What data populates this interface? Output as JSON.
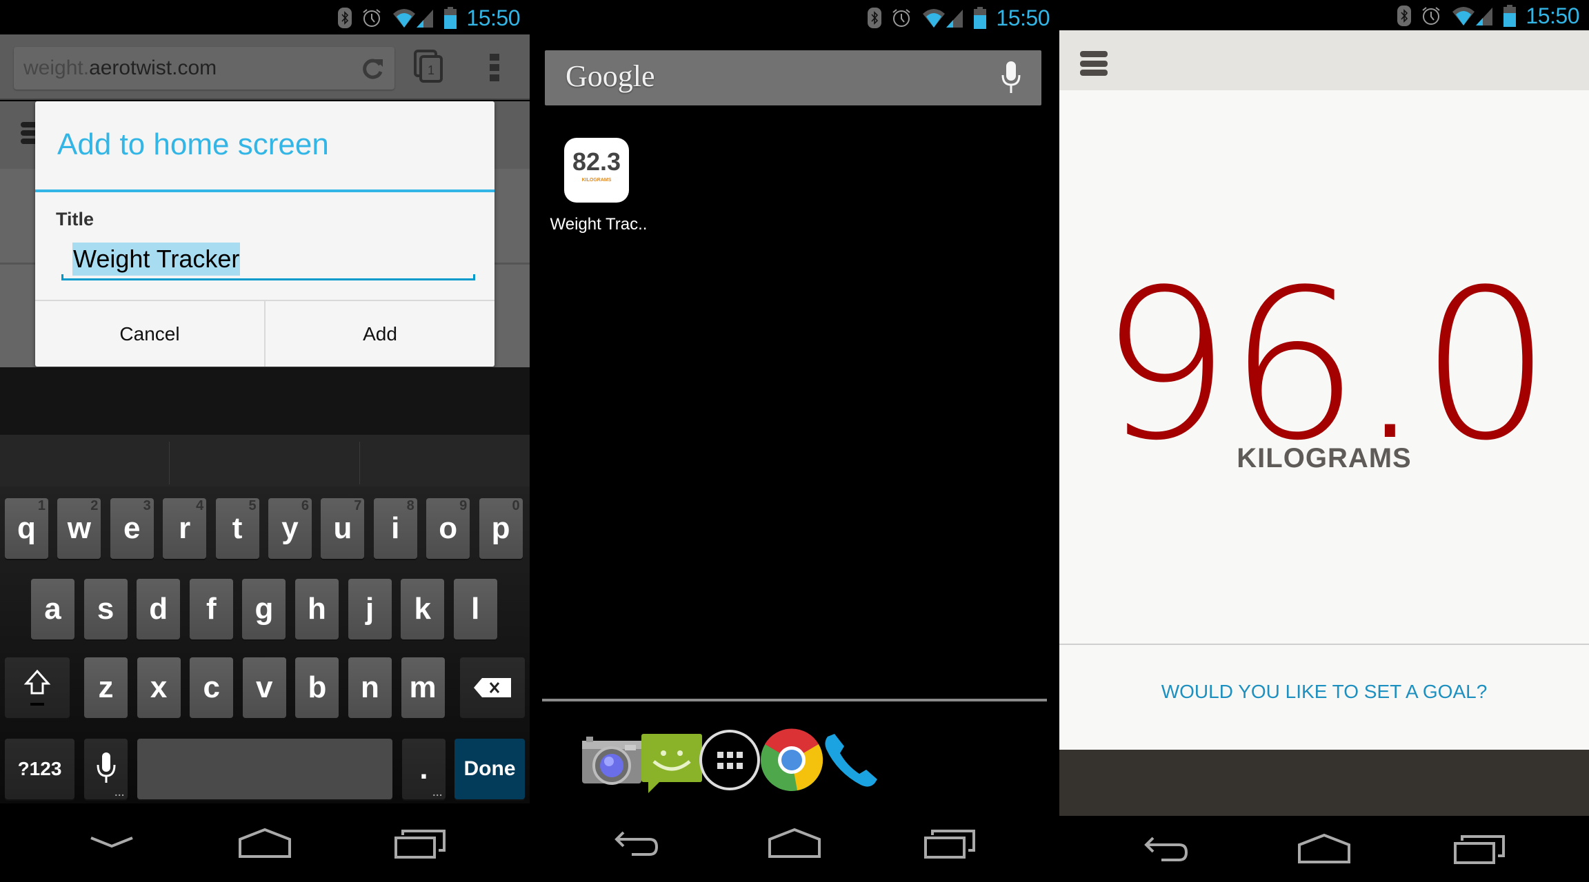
{
  "status_bar": {
    "time": "15:50",
    "icons": [
      "bluetooth-icon",
      "alarm-icon",
      "wifi-icon",
      "signal-icon",
      "battery-icon"
    ],
    "accent_color": "#33b5e5"
  },
  "browser": {
    "url_host_prefix": "weight.",
    "url_domain": "aerotwist.com",
    "tab_count": "1",
    "icons": [
      "reload-icon",
      "tabs-icon",
      "overflow-menu-icon"
    ]
  },
  "dialog": {
    "title": "Add to home screen",
    "field_label": "Title",
    "field_value": "Weight Tracker",
    "cancel_label": "Cancel",
    "add_label": "Add",
    "accent_color": "#33b5e5"
  },
  "keyboard": {
    "row1": [
      {
        "key": "q",
        "num": "1"
      },
      {
        "key": "w",
        "num": "2"
      },
      {
        "key": "e",
        "num": "3"
      },
      {
        "key": "r",
        "num": "4"
      },
      {
        "key": "t",
        "num": "5"
      },
      {
        "key": "y",
        "num": "6"
      },
      {
        "key": "u",
        "num": "7"
      },
      {
        "key": "i",
        "num": "8"
      },
      {
        "key": "o",
        "num": "9"
      },
      {
        "key": "p",
        "num": "0"
      }
    ],
    "row2": [
      "a",
      "s",
      "d",
      "f",
      "g",
      "h",
      "j",
      "k",
      "l"
    ],
    "row3": [
      "z",
      "x",
      "c",
      "v",
      "b",
      "n",
      "m"
    ],
    "symbols_label": "?123",
    "period_label": ".",
    "done_label": "Done",
    "done_color": "#033c5a"
  },
  "home": {
    "search_logo": "Google",
    "app_icon_value": "82.3",
    "app_icon_unit": "KILOGRAMS",
    "app_label": "Weight Trac..",
    "dock": [
      "camera-icon",
      "messaging-icon",
      "app-drawer-icon",
      "chrome-icon",
      "phone-icon"
    ]
  },
  "weight_app": {
    "value": "96.0",
    "unit": "KILOGRAMS",
    "goal_prompt": "WOULD YOU LIKE TO SET A GOAL?",
    "value_color": "#a40000",
    "link_color": "#1e90c0"
  },
  "navigation": {
    "panel1": [
      "hide-keyboard-icon",
      "home-icon",
      "recents-icon"
    ],
    "panel2": [
      "back-icon",
      "home-icon",
      "recents-icon"
    ],
    "panel3": [
      "back-icon",
      "home-icon",
      "recents-icon"
    ]
  }
}
